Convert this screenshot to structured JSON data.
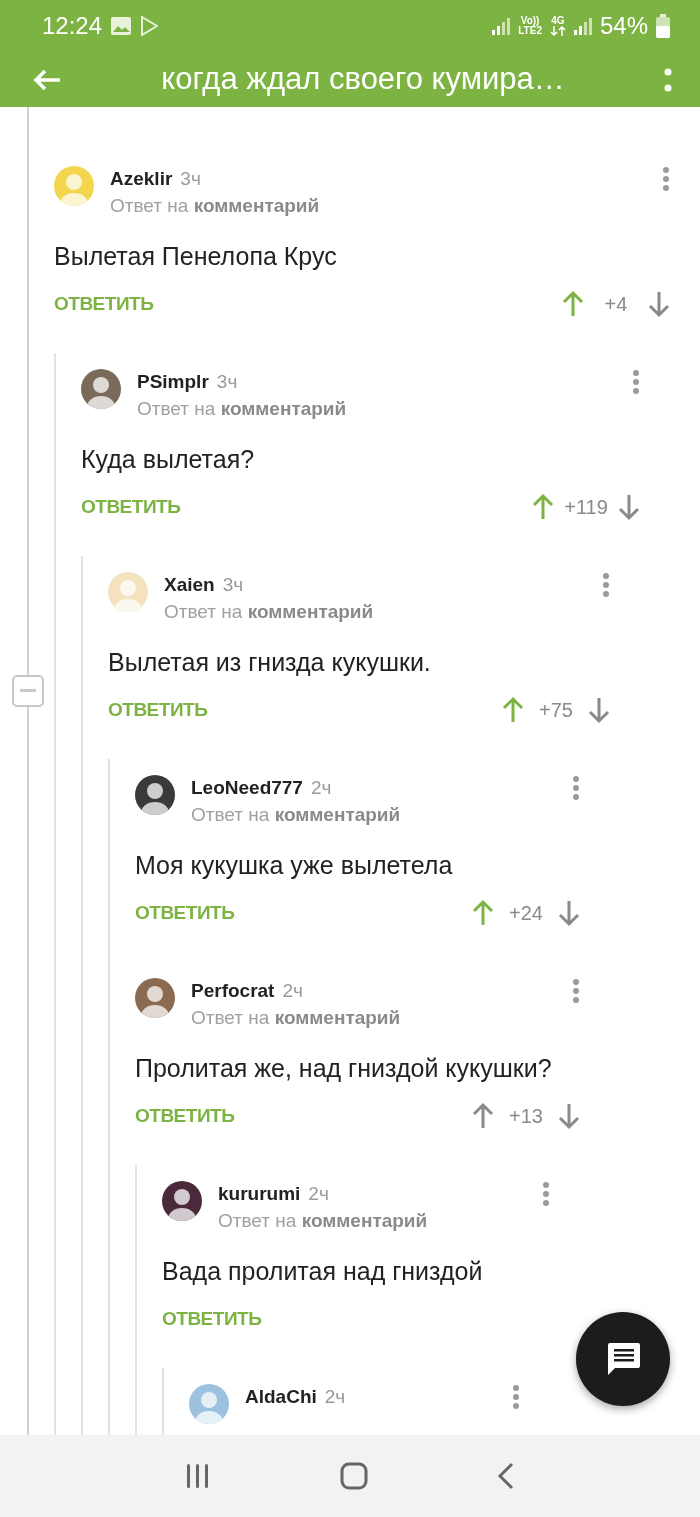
{
  "status_bar": {
    "time": "12:24",
    "volte": "Vo))",
    "lte": "LTE2",
    "network": "4G",
    "battery": "54%"
  },
  "header": {
    "title": "когда ждал своего кумира…"
  },
  "comments": [
    {
      "author": "Azeklir",
      "time": "3ч",
      "subtitle": "Ответ на **комментарий**",
      "text": "Вылетая Пенелопа Крус",
      "reply": "ОТВЕТИТЬ",
      "score": "+4",
      "upvoted": true,
      "children": [
        {
          "author": "PSimplr",
          "time": "3ч",
          "subtitle": "Ответ на **комментарий**",
          "text": "Куда вылетая?",
          "reply": "ОТВЕТИТЬ",
          "score": "+119",
          "upvoted": true,
          "children": [
            {
              "author": "Xaien",
              "time": "3ч",
              "subtitle": "Ответ на **комментарий**",
              "text": "Вылетая из гнизда кукушки.",
              "reply": "ОТВЕТИТЬ",
              "score": "+75",
              "upvoted": true,
              "children": [
                {
                  "author": "LeoNeed777",
                  "time": "2ч",
                  "subtitle": "Ответ на **комментарий**",
                  "text": "Моя кукушка уже вылетела",
                  "reply": "ОТВЕТИТЬ",
                  "score": "+24",
                  "upvoted": true
                },
                {
                  "author": "Perfocrat",
                  "time": "2ч",
                  "subtitle": "Ответ на **комментарий**",
                  "text": "Пролитая же, над гниздой кукушки?",
                  "reply": "ОТВЕТИТЬ",
                  "score": "+13",
                  "upvoted": false,
                  "children": [
                    {
                      "author": "kururumi",
                      "time": "2ч",
                      "subtitle": "Ответ на **комментарий**",
                      "text": "Вада пролитая над гниздой",
                      "reply": "ОТВЕТИТЬ",
                      "children": [
                        {
                          "author": "AldaChi",
                          "time": "2ч"
                        }
                      ]
                    }
                  ]
                }
              ]
            }
          ]
        }
      ]
    }
  ]
}
